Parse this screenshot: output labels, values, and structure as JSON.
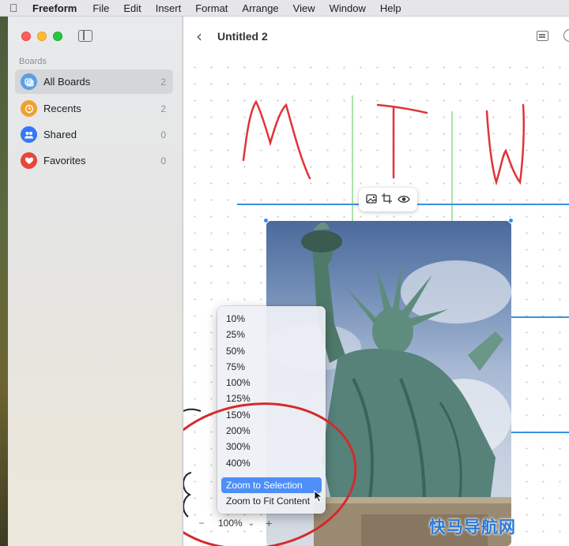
{
  "menubar": {
    "apple_icon": "apple-logo-icon",
    "app_name": "Freeform",
    "items": [
      "File",
      "Edit",
      "Insert",
      "Format",
      "Arrange",
      "View",
      "Window",
      "Help"
    ]
  },
  "sidebar": {
    "heading": "Boards",
    "items": [
      {
        "label": "All Boards",
        "count": "2",
        "icon": "boards-icon",
        "color": "#5aa0e6",
        "selected": true
      },
      {
        "label": "Recents",
        "count": "2",
        "icon": "clock-icon",
        "color": "#f0a030",
        "selected": false
      },
      {
        "label": "Shared",
        "count": "0",
        "icon": "people-icon",
        "color": "#3478f6",
        "selected": false
      },
      {
        "label": "Favorites",
        "count": "0",
        "icon": "heart-icon",
        "color": "#e8453c",
        "selected": false
      }
    ]
  },
  "document": {
    "title": "Untitled 2"
  },
  "zoom_menu": {
    "options": [
      "10%",
      "25%",
      "50%",
      "75%",
      "100%",
      "125%",
      "150%",
      "200%",
      "300%",
      "400%"
    ],
    "zoom_to_selection": "Zoom to Selection",
    "zoom_to_fit": "Zoom to Fit Content"
  },
  "zoom_bar": {
    "value": "100%"
  },
  "canvas": {
    "handwriting": "MTW",
    "accent_line_color": "#3b8fe0",
    "guide_line_color": "#8fd88f",
    "ink_color": "#e0343a"
  },
  "watermark": "快马导航网"
}
